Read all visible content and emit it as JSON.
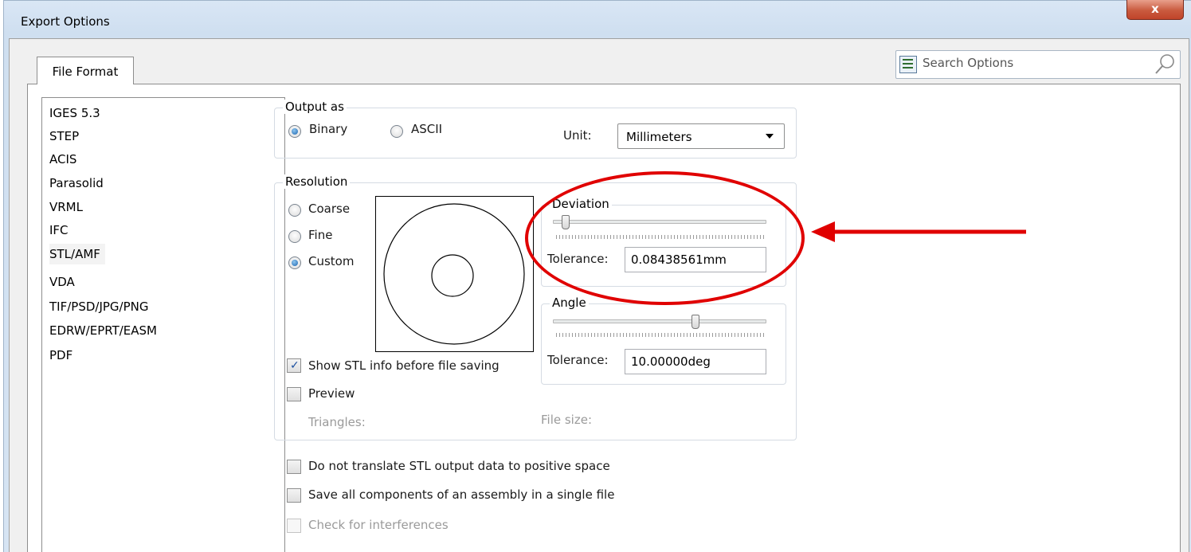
{
  "window": {
    "title": "Export Options",
    "close_label": "x"
  },
  "tab": {
    "label": "File Format"
  },
  "search": {
    "placeholder": "Search Options"
  },
  "formats": [
    "IGES 5.3",
    "STEP",
    "ACIS",
    "Parasolid",
    "VRML",
    "IFC",
    "STL/AMF",
    "VDA",
    "TIF/PSD/JPG/PNG",
    "EDRW/EPRT/EASM",
    "PDF"
  ],
  "selected_format": "STL/AMF",
  "output": {
    "title": "Output as",
    "binary_label": "Binary",
    "ascii_label": "ASCII",
    "selected": "Binary",
    "unit_label": "Unit:",
    "unit_value": "Millimeters"
  },
  "resolution": {
    "title": "Resolution",
    "coarse_label": "Coarse",
    "fine_label": "Fine",
    "custom_label": "Custom",
    "selected": "Custom",
    "deviation": {
      "title": "Deviation",
      "slider_level": 0.09,
      "tolerance_label": "Tolerance:",
      "tolerance_value": "0.08438561mm"
    },
    "angle": {
      "title": "Angle",
      "slider_level": 0.69,
      "tolerance_label": "Tolerance:",
      "tolerance_value": "10.00000deg"
    },
    "show_info_label": "Show STL info before file saving",
    "show_info_checked": true,
    "preview_label": "Preview",
    "preview_checked": false,
    "triangles_label": "Triangles:",
    "file_size_label": "File size:"
  },
  "options": {
    "no_translate_label": "Do not translate STL output data to positive space",
    "save_all_label": "Save all components of an assembly in a single file",
    "check_interferences_label": "Check for interferences"
  },
  "annotation": {
    "color": "#e00000"
  }
}
